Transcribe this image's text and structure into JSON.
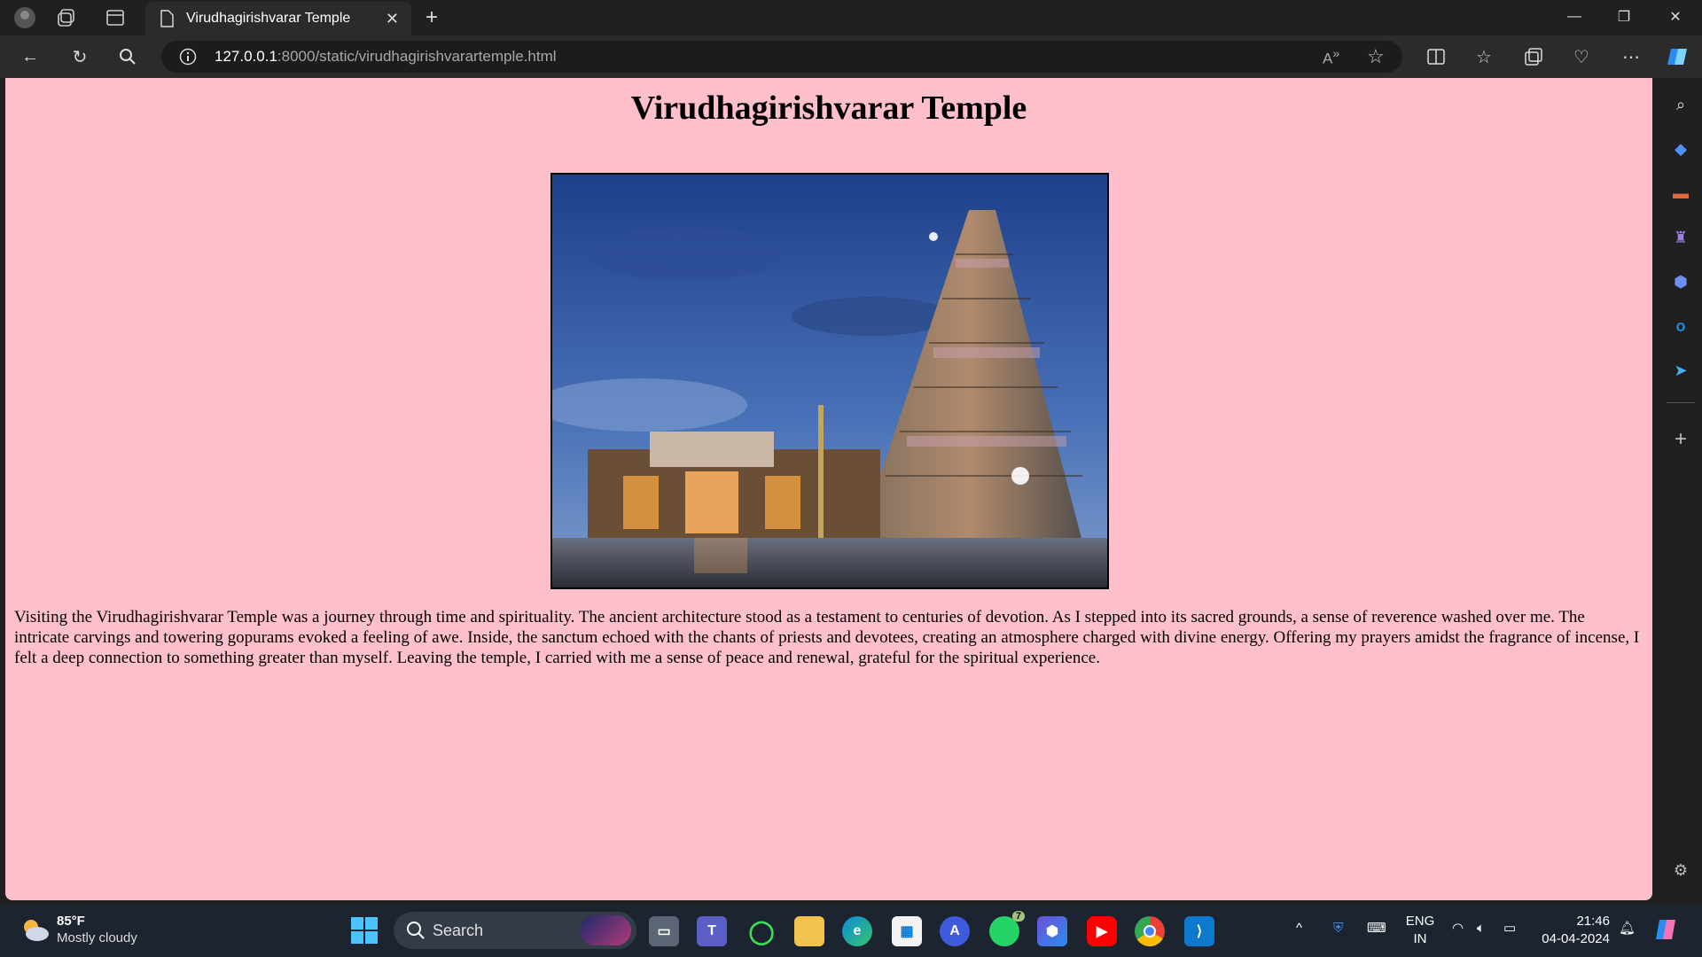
{
  "browser": {
    "tab_title": "Virudhagirishvarar Temple",
    "url_host": "127.0.0.1",
    "url_rest": ":8000/static/virudhagirishvarartemple.html"
  },
  "page": {
    "title": "Virudhagirishvarar Temple",
    "image_alt": "Virudhagirishvarar Temple gopuram at dusk",
    "paragraph": "Visiting the Virudhagirishvarar Temple was a journey through time and spirituality. The ancient architecture stood as a testament to centuries of devotion. As I stepped into its sacred grounds, a sense of reverence washed over me. The intricate carvings and towering gopurams evoked a feeling of awe. Inside, the sanctum echoed with the chants of priests and devotees, creating an atmosphere charged with divine energy. Offering my prayers amidst the fragrance of incense, I felt a deep connection to something greater than myself. Leaving the temple, I carried with me a sense of peace and renewal, grateful for the spiritual experience."
  },
  "taskbar": {
    "weather_temp": "85°F",
    "weather_desc": "Mostly cloudy",
    "search_label": "Search",
    "whatsapp_badge": "7",
    "lang_primary": "ENG",
    "lang_secondary": "IN",
    "time": "21:46",
    "date": "04-04-2024"
  },
  "colors": {
    "page_bg": "#ffc0cb",
    "browser_chrome": "#202020",
    "taskbar_bg": "#1c2430"
  }
}
